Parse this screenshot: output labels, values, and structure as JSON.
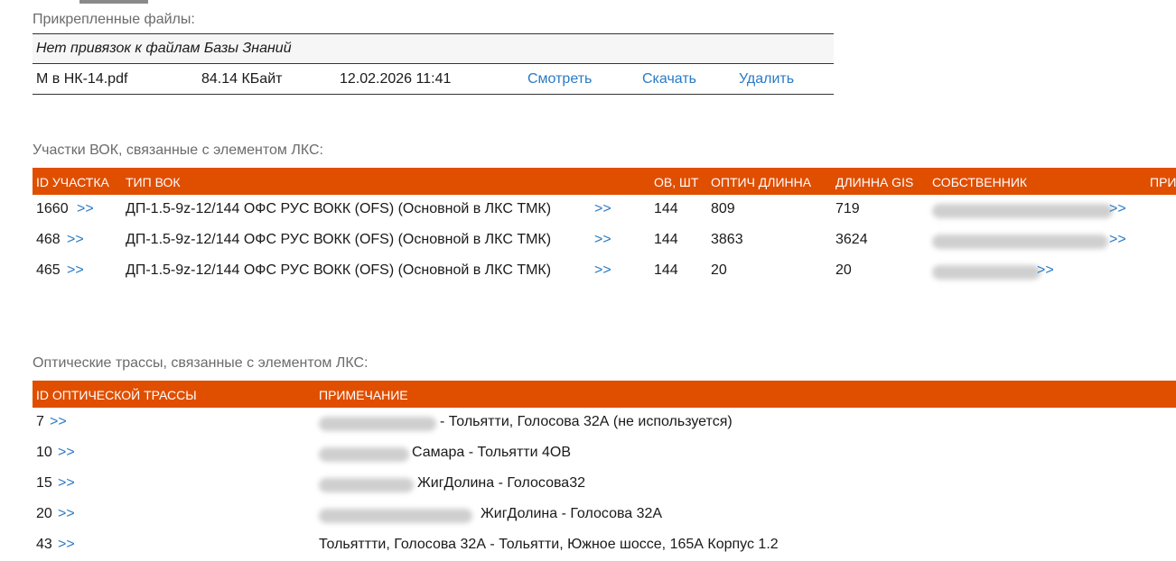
{
  "attached": {
    "title": "Прикрепленные файлы:",
    "no_kb_links": "Нет привязок к файлам Базы Знаний",
    "file": {
      "name": "М в НК-14.pdf",
      "size": "84.14 КБайт",
      "date": "12.02.2026 11:41",
      "view": "Смотреть",
      "download": "Скачать",
      "delete": "Удалить"
    }
  },
  "vok": {
    "title": "Участки ВОК, связанные с элементом ЛКС:",
    "headers": [
      "ID УЧАСТКА",
      "ТИП ВОК",
      "ОВ, ШТ",
      "ОПТИЧ ДЛИННА",
      "ДЛИННА GIS",
      "СОБСТВЕННИК",
      "ПРИ"
    ],
    "more": ">>",
    "rows": [
      {
        "id": "1660",
        "type": "ДП-1.5-9z-12/144 ОФС РУС ВОКК (OFS) (Основной в ЛКС ТМК)",
        "ov": "144",
        "optical": "809",
        "gis": "719",
        "owner_tail": "ИТИ ...>>"
      },
      {
        "id": "468",
        "type": "ДП-1.5-9z-12/144 ОФС РУС ВОКК (OFS) (Основной в ЛКС ТМК)",
        "ov": "144",
        "optical": "3863",
        "gis": "3624",
        "owner_tail": ">>"
      },
      {
        "id": "465",
        "type": "ДП-1.5-9z-12/144 ОФС РУС ВОКК (OFS) (Основной в ЛКС ТМК)",
        "ov": "144",
        "optical": "20",
        "gis": "20",
        "owner_tail": ">>"
      }
    ]
  },
  "routes": {
    "title": "Оптические трассы, связанные с элементом ЛКС:",
    "headers": [
      "ID ОПТИЧЕСКОЙ ТРАССЫ",
      "ПРИМЕЧАНИЕ"
    ],
    "more": ">>",
    "rows": [
      {
        "id": "7",
        "note": "- Тольятти, Голосова 32А (не используется)"
      },
      {
        "id": "10",
        "note": "Самара - Тольятти 4ОВ"
      },
      {
        "id": "15",
        "note": "ЖигДолина - Голосова32"
      },
      {
        "id": "20",
        "note": "ЖигДолина - Голосова 32А"
      },
      {
        "id": "43",
        "note": "Тольяттти, Голосова 32А - Тольятти, Южное шоссе, 165А Корпус 1.2"
      }
    ]
  }
}
